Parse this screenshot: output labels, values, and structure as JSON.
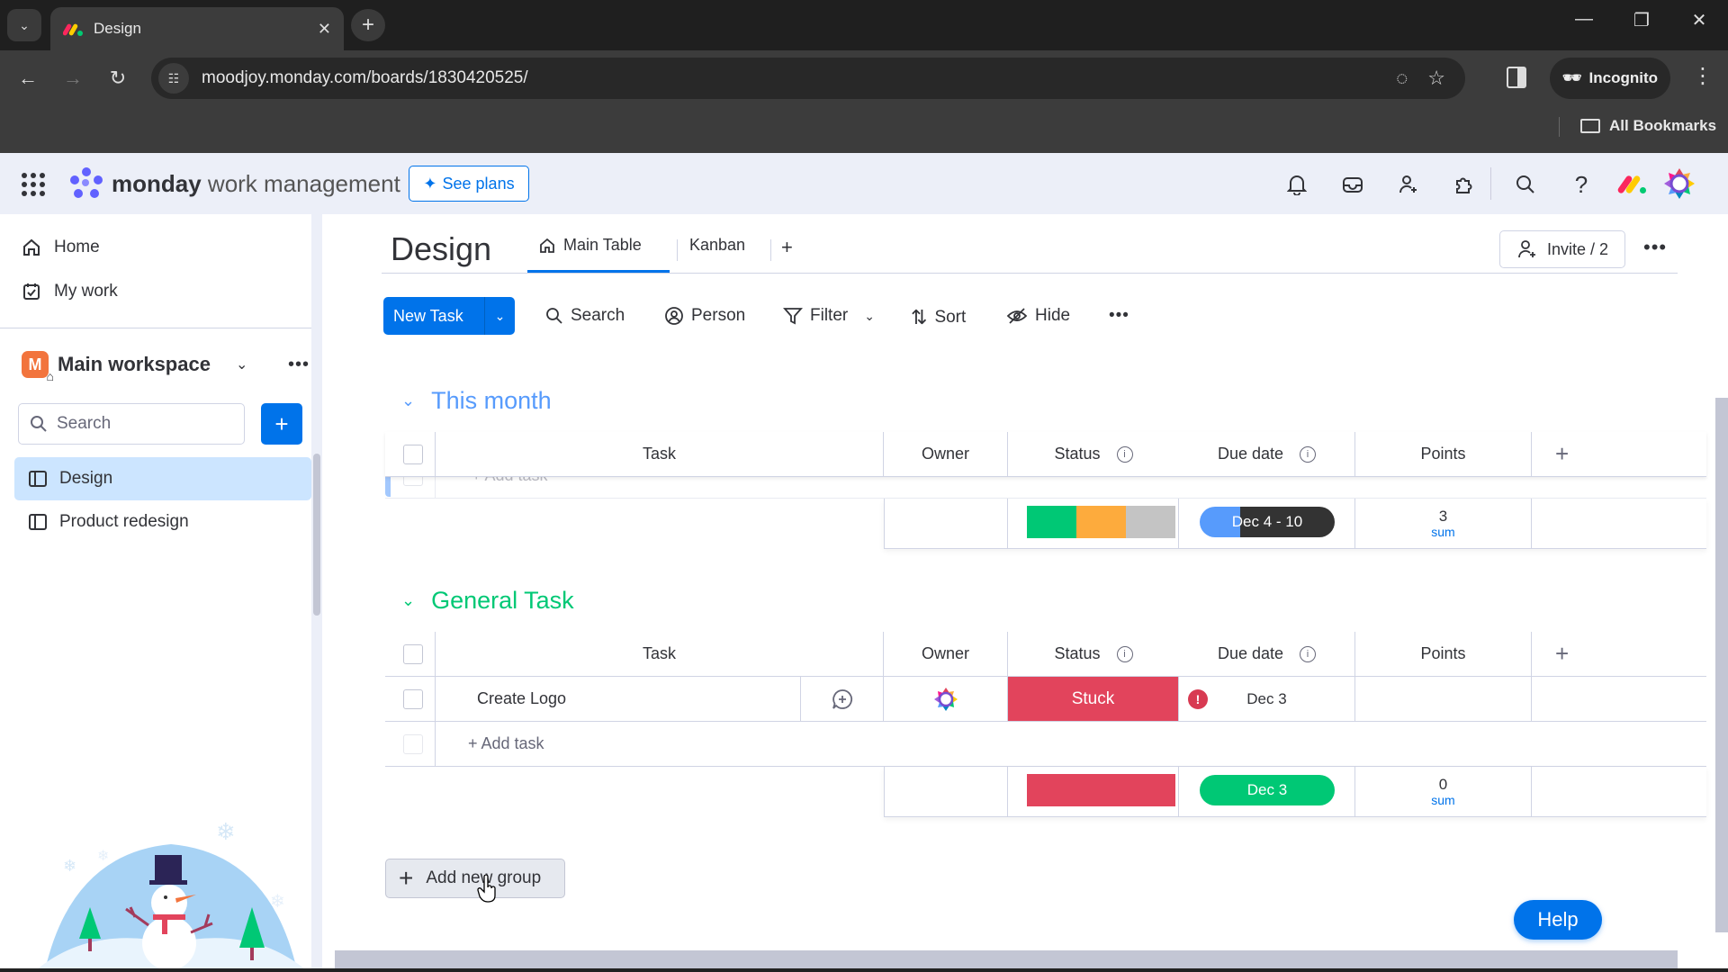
{
  "browser": {
    "tab_title": "Design",
    "url": "moodjoy.monday.com/boards/1830420525/",
    "incognito_label": "Incognito",
    "bookmarks_label": "All Bookmarks"
  },
  "appbar": {
    "brand_bold": "monday",
    "brand_light": " work management",
    "see_plans": "See plans",
    "icons": [
      "bell-icon",
      "inbox-icon",
      "invite-members-icon",
      "apps-puzzle-icon",
      "search-icon",
      "help-icon"
    ]
  },
  "sidebar": {
    "nav": [
      {
        "label": "Home",
        "icon": "home-icon"
      },
      {
        "label": "My work",
        "icon": "calendar-check-icon"
      }
    ],
    "workspace": {
      "badge": "M",
      "name": "Main workspace"
    },
    "search_placeholder": "Search",
    "boards": [
      {
        "label": "Design",
        "active": true
      },
      {
        "label": "Product redesign",
        "active": false
      }
    ]
  },
  "board": {
    "title": "Design",
    "views": [
      {
        "label": "Main Table",
        "active": true
      },
      {
        "label": "Kanban",
        "active": false
      }
    ],
    "add_view": "+",
    "invite_label": "Invite / 2",
    "toolbar": {
      "new_task": "New Task",
      "search": "Search",
      "person": "Person",
      "filter": "Filter",
      "sort": "Sort",
      "hide": "Hide"
    },
    "columns": [
      "Task",
      "Owner",
      "Status",
      "Due date",
      "Points"
    ],
    "groups": [
      {
        "name": "This month",
        "color": "#579bfc",
        "items": [],
        "add_task_label": "+ Add task",
        "summary": {
          "status_segments": [
            {
              "color": "#00c875",
              "fraction": 0.3333
            },
            {
              "color": "#fdab3d",
              "fraction": 0.3333
            },
            {
              "color": "#c4c4c4",
              "fraction": 0.3334
            }
          ],
          "date_range": "Dec 4 - 10",
          "date_progress": 0.3,
          "points_sum": "3",
          "sum_label": "sum"
        }
      },
      {
        "name": "General Task",
        "color": "#00c875",
        "items": [
          {
            "task": "Create Logo",
            "status": "Stuck",
            "status_color": "#e2445c",
            "due_date": "Dec 3",
            "overdue": true,
            "points": ""
          }
        ],
        "add_task_label": "+ Add task",
        "summary": {
          "status_segments": [
            {
              "color": "#e2445c",
              "fraction": 1.0
            }
          ],
          "date_range": "Dec 3",
          "date_color": "#00c875",
          "points_sum": "0",
          "sum_label": "sum"
        }
      }
    ],
    "add_group_label": "Add new group",
    "help_label": "Help"
  }
}
